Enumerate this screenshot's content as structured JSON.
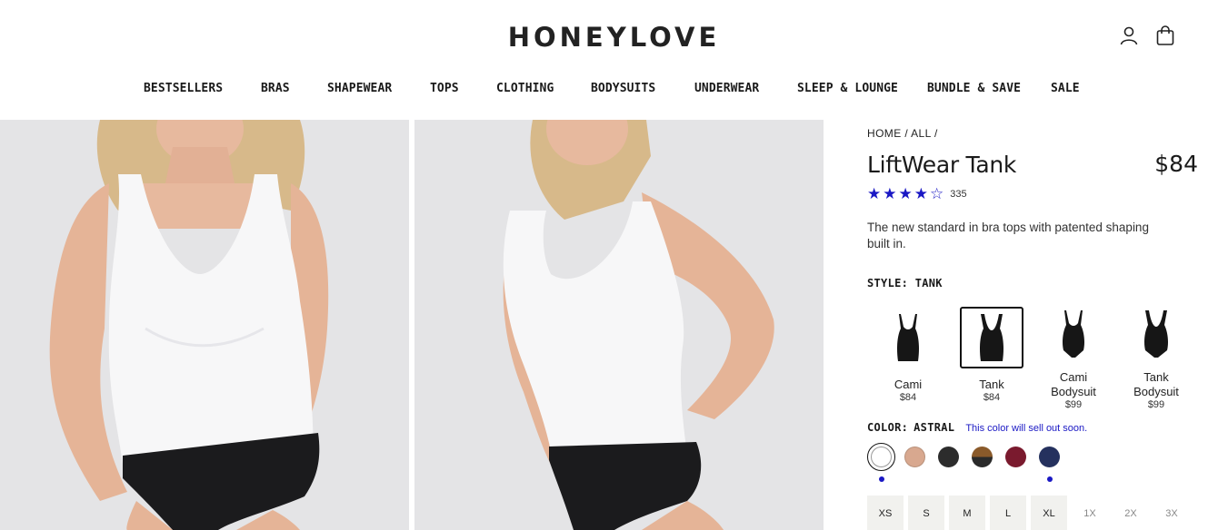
{
  "brand": {
    "logo": "HONEYLOVE"
  },
  "header": {
    "account_icon": "user-icon",
    "cart_icon": "shopping-bag-icon"
  },
  "nav": {
    "items": [
      "BESTSELLERS",
      "BRAS",
      "SHAPEWEAR",
      "TOPS",
      "CLOTHING",
      "BODYSUITS",
      "UNDERWEAR",
      "SLEEP & LOUNGE",
      "BUNDLE & SAVE",
      "SALE"
    ]
  },
  "product": {
    "breadcrumb": [
      "HOME",
      "ALL"
    ],
    "breadcrumb_separator": "/",
    "title": "LiftWear Tank",
    "price": "$84",
    "rating": 4.5,
    "rating_stars": [
      "★",
      "★",
      "★",
      "★",
      "☆"
    ],
    "review_count": "335",
    "description": "The new standard in bra tops with patented shaping built in.",
    "style": {
      "label": "STYLE:",
      "selected": "TANK",
      "options": [
        {
          "name": "Cami",
          "price": "$84",
          "icon": "cami-thumbnail"
        },
        {
          "name": "Tank",
          "price": "$84",
          "icon": "tank-thumbnail"
        },
        {
          "name": "Cami Bodysuit",
          "price": "$99",
          "icon": "cami-bodysuit-thumbnail"
        },
        {
          "name": "Tank Bodysuit",
          "price": "$99",
          "icon": "tank-bodysuit-thumbnail"
        }
      ]
    },
    "color": {
      "label": "COLOR:",
      "selected": "ASTRAL",
      "notice": "This color will sell out soon.",
      "swatches": [
        {
          "color": "#ffffff",
          "selected": true,
          "dot": true
        },
        {
          "color": "#d8a88f",
          "selected": false,
          "dot": false
        },
        {
          "color": "#2c2c2c",
          "selected": false,
          "dot": false
        },
        {
          "color": "split-brown-black",
          "selected": false,
          "dot": false
        },
        {
          "color": "#7a1a2e",
          "selected": false,
          "dot": false
        },
        {
          "color": "#25315e",
          "selected": false,
          "dot": true
        }
      ]
    },
    "sizes": [
      {
        "label": "XS",
        "available": true
      },
      {
        "label": "S",
        "available": true
      },
      {
        "label": "M",
        "available": true
      },
      {
        "label": "L",
        "available": true
      },
      {
        "label": "XL",
        "available": true
      },
      {
        "label": "1X",
        "available": false
      },
      {
        "label": "2X",
        "available": false
      },
      {
        "label": "3X",
        "available": false
      }
    ]
  },
  "colors": {
    "accent": "#1a18c4",
    "photo_bg": "#e4e4e6"
  }
}
